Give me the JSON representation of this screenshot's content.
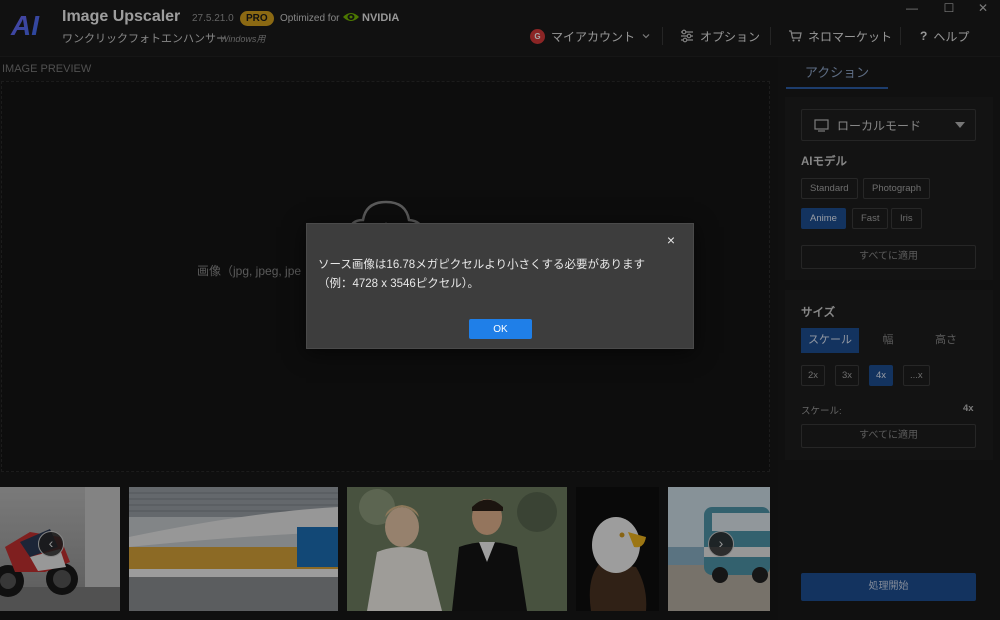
{
  "app": {
    "name": "Image Upscaler",
    "version": "27.5.21.0",
    "badge": "PRO",
    "optimized_for": "Optimized for",
    "gpu_brand": "NVIDIA",
    "subtitle": "ワンクリックフォトエンハンサー",
    "subtitle_os": "Windows用",
    "logo_text": "AI"
  },
  "menu": {
    "account_initial": "G",
    "account": "マイアカウント",
    "options": "オプション",
    "market": "ネロマーケット",
    "help_symbol": "?",
    "help": "ヘルプ"
  },
  "window_controls": {
    "minimize": "—",
    "maximize": "☐",
    "close": "✕"
  },
  "preview": {
    "label": "IMAGE PREVIEW",
    "hint": "画像（jpg, jpeg, jpe"
  },
  "thumbnails": {
    "prev": "‹",
    "next": "›",
    "items": [
      "motorcycle",
      "building",
      "wedding",
      "eagle",
      "van"
    ]
  },
  "sidebar": {
    "tab": "アクション",
    "mode": "ローカルモード",
    "ai_model_title": "AIモデル",
    "models": [
      "Standard",
      "Photograph",
      "Anime",
      "Fast",
      "Iris"
    ],
    "active_model": "Anime",
    "apply_all": "すべてに適用",
    "size_title": "サイズ",
    "size_modes": [
      "スケール",
      "幅",
      "高さ"
    ],
    "active_size_mode": "スケール",
    "scales": [
      "2x",
      "3x",
      "4x",
      "...x"
    ],
    "active_scale": "4x",
    "scale_label": "スケール:",
    "scale_value": "4x",
    "apply_all_2": "すべてに適用",
    "start": "処理開始"
  },
  "dialog": {
    "close": "×",
    "line1": "ソース画像は16.78メガピクセルより小さくする必要があります",
    "line2": "（例：4728 x 3546ピクセル）。",
    "ok": "OK"
  },
  "colors": {
    "accent": "#1e4f93",
    "ok_button": "#1f7fe8",
    "pro_badge": "#d6a21e",
    "nvidia_green": "#76b900"
  }
}
